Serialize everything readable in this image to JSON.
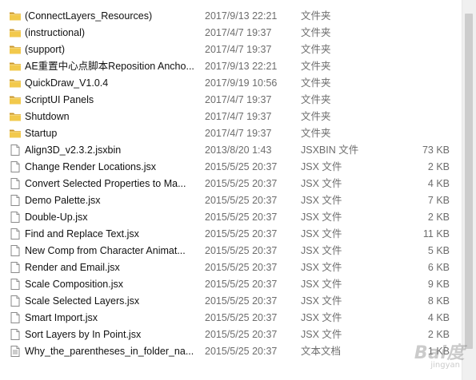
{
  "files": [
    {
      "name": "(ConnectLayers_Resources)",
      "date": "2017/9/13 22:21",
      "type": "文件夹",
      "size": "",
      "icon": "folder-icon"
    },
    {
      "name": "(instructional)",
      "date": "2017/4/7 19:37",
      "type": "文件夹",
      "size": "",
      "icon": "folder-icon"
    },
    {
      "name": "(support)",
      "date": "2017/4/7 19:37",
      "type": "文件夹",
      "size": "",
      "icon": "folder-icon"
    },
    {
      "name": "AE重置中心点脚本Reposition Ancho...",
      "date": "2017/9/13 22:21",
      "type": "文件夹",
      "size": "",
      "icon": "folder-icon"
    },
    {
      "name": "QuickDraw_V1.0.4",
      "date": "2017/9/19 10:56",
      "type": "文件夹",
      "size": "",
      "icon": "folder-icon"
    },
    {
      "name": "ScriptUI Panels",
      "date": "2017/4/7 19:37",
      "type": "文件夹",
      "size": "",
      "icon": "folder-icon"
    },
    {
      "name": "Shutdown",
      "date": "2017/4/7 19:37",
      "type": "文件夹",
      "size": "",
      "icon": "folder-icon"
    },
    {
      "name": "Startup",
      "date": "2017/4/7 19:37",
      "type": "文件夹",
      "size": "",
      "icon": "folder-icon"
    },
    {
      "name": "Align3D_v2.3.2.jsxbin",
      "date": "2013/8/20 1:43",
      "type": "JSXBIN 文件",
      "size": "73 KB",
      "icon": "file-icon"
    },
    {
      "name": "Change Render Locations.jsx",
      "date": "2015/5/25 20:37",
      "type": "JSX 文件",
      "size": "2 KB",
      "icon": "file-icon"
    },
    {
      "name": "Convert Selected Properties to Ma...",
      "date": "2015/5/25 20:37",
      "type": "JSX 文件",
      "size": "4 KB",
      "icon": "file-icon"
    },
    {
      "name": "Demo Palette.jsx",
      "date": "2015/5/25 20:37",
      "type": "JSX 文件",
      "size": "7 KB",
      "icon": "file-icon"
    },
    {
      "name": "Double-Up.jsx",
      "date": "2015/5/25 20:37",
      "type": "JSX 文件",
      "size": "2 KB",
      "icon": "file-icon"
    },
    {
      "name": "Find and Replace Text.jsx",
      "date": "2015/5/25 20:37",
      "type": "JSX 文件",
      "size": "11 KB",
      "icon": "file-icon"
    },
    {
      "name": "New Comp from Character Animat...",
      "date": "2015/5/25 20:37",
      "type": "JSX 文件",
      "size": "5 KB",
      "icon": "file-icon"
    },
    {
      "name": "Render and Email.jsx",
      "date": "2015/5/25 20:37",
      "type": "JSX 文件",
      "size": "6 KB",
      "icon": "file-icon"
    },
    {
      "name": "Scale Composition.jsx",
      "date": "2015/5/25 20:37",
      "type": "JSX 文件",
      "size": "9 KB",
      "icon": "file-icon"
    },
    {
      "name": "Scale Selected Layers.jsx",
      "date": "2015/5/25 20:37",
      "type": "JSX 文件",
      "size": "8 KB",
      "icon": "file-icon"
    },
    {
      "name": "Smart Import.jsx",
      "date": "2015/5/25 20:37",
      "type": "JSX 文件",
      "size": "4 KB",
      "icon": "file-icon"
    },
    {
      "name": "Sort Layers by In Point.jsx",
      "date": "2015/5/25 20:37",
      "type": "JSX 文件",
      "size": "2 KB",
      "icon": "file-icon"
    },
    {
      "name": "Why_the_parentheses_in_folder_na...",
      "date": "2015/5/25 20:37",
      "type": "文本文档",
      "size": "1 KB",
      "icon": "text-document-icon"
    }
  ],
  "watermark": {
    "text": "Bai度",
    "sub": "jingyan"
  },
  "colors": {
    "folder": "#e8b93c",
    "folder_dark": "#c9952a",
    "text_secondary": "#6d6d6d"
  }
}
